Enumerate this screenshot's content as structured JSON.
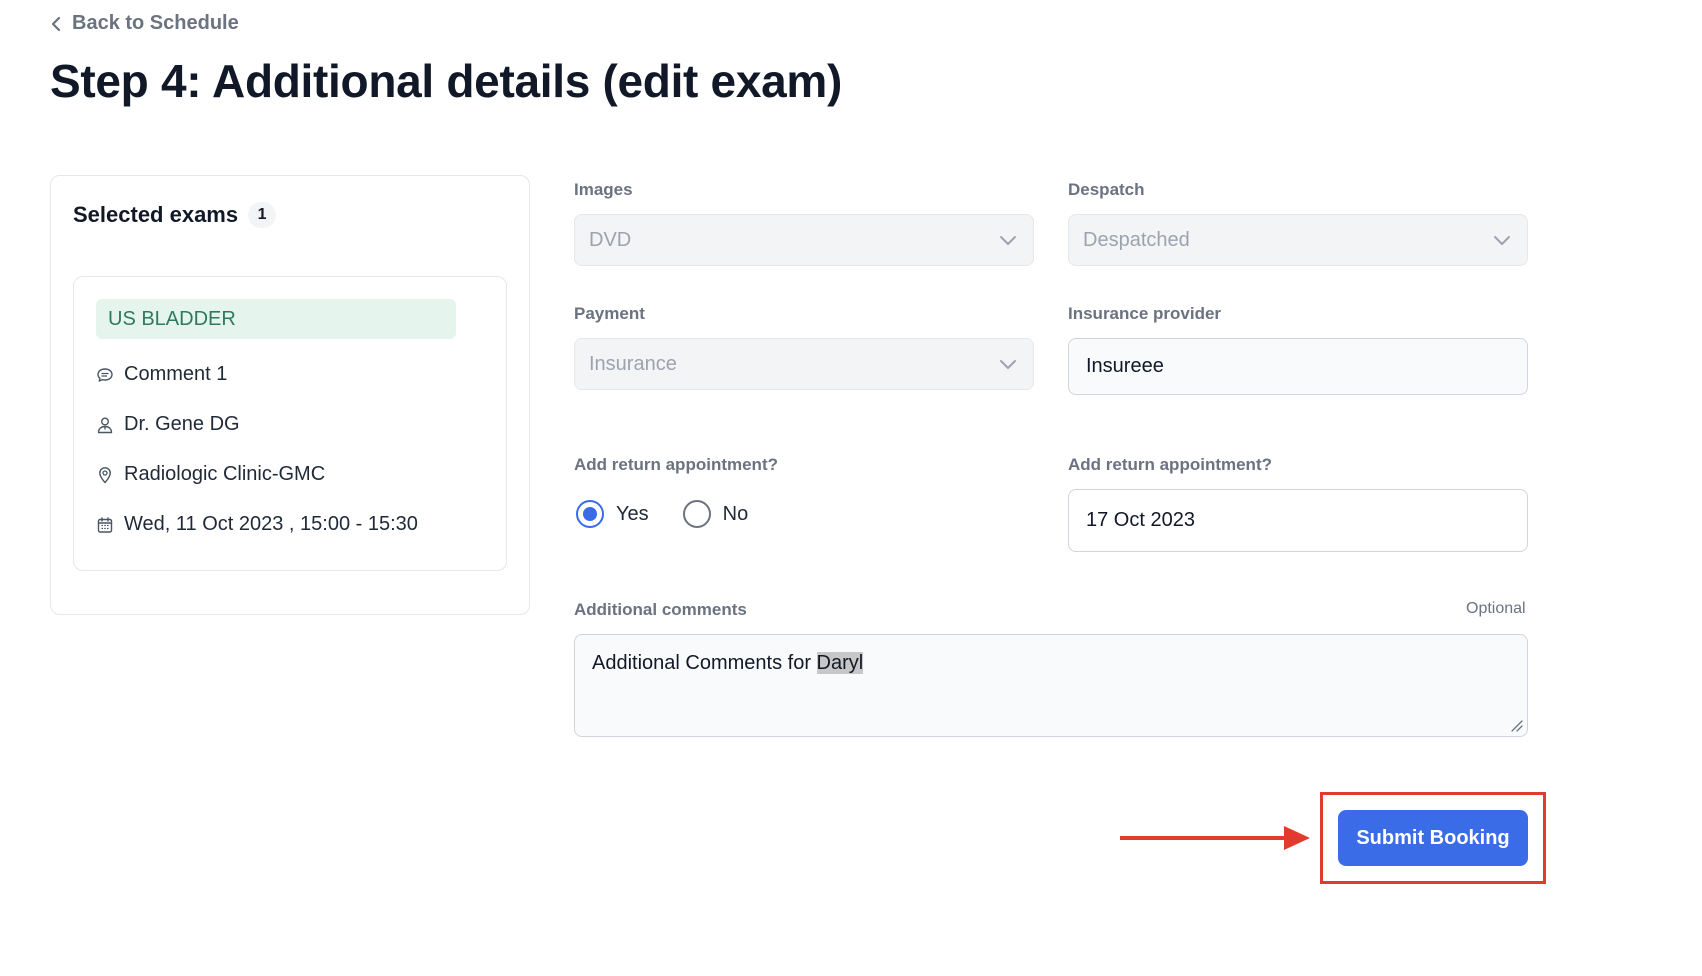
{
  "nav": {
    "back_label": "Back to Schedule"
  },
  "page": {
    "title": "Step 4: Additional details (edit exam)"
  },
  "selected_exams": {
    "title": "Selected exams",
    "count": "1",
    "items": [
      {
        "exam_name": "US BLADDER",
        "comment": "Comment 1",
        "doctor": "Dr. Gene DG",
        "location": "Radiologic Clinic-GMC",
        "datetime": "Wed, 11 Oct 2023 , 15:00 - 15:30"
      }
    ]
  },
  "form": {
    "images": {
      "label": "Images",
      "value": "DVD"
    },
    "despatch": {
      "label": "Despatch",
      "value": "Despatched"
    },
    "payment": {
      "label": "Payment",
      "value": "Insurance"
    },
    "insurance_provider": {
      "label": "Insurance provider",
      "value": "Insureee"
    },
    "return_appointment": {
      "label": "Add return appointment?",
      "options": [
        "Yes",
        "No"
      ],
      "selected": "Yes"
    },
    "return_date": {
      "label": "Add return appointment?",
      "value": "17 Oct 2023"
    },
    "additional_comments": {
      "label": "Additional comments",
      "optional_label": "Optional",
      "value_prefix": "Additional Comments for ",
      "value_highlight": "Daryl"
    }
  },
  "actions": {
    "submit_label": "Submit Booking"
  },
  "colors": {
    "primary": "#3b6ce7",
    "annotation": "#e23b2e",
    "tag_bg": "#e6f4ee",
    "tag_text": "#2f7a5f"
  },
  "icons": [
    "chevron-left-icon",
    "chevron-down-icon",
    "comment-icon",
    "user-icon",
    "location-pin-icon",
    "calendar-icon",
    "arrow-right-icon"
  ]
}
